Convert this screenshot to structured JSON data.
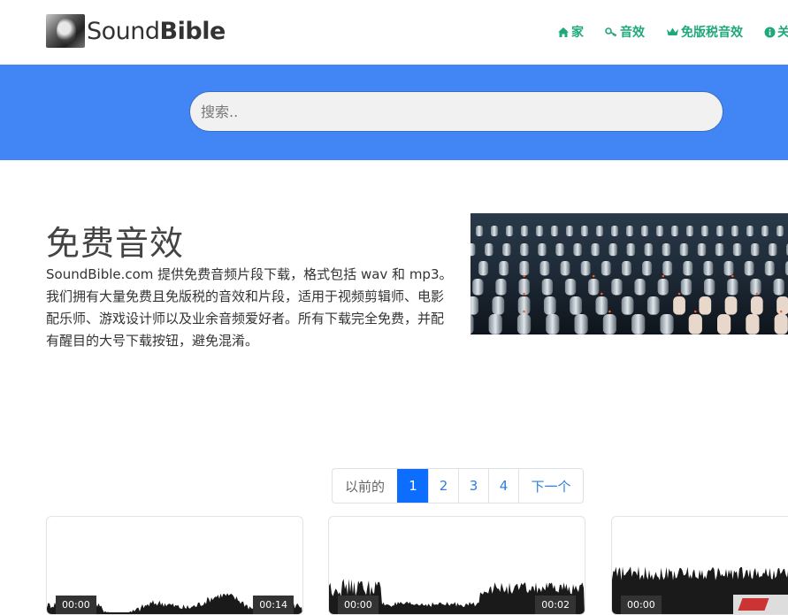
{
  "logo": {
    "brand_light": "Sound",
    "brand_bold": "Bible"
  },
  "nav": [
    {
      "label": "家",
      "icon": "home-icon"
    },
    {
      "label": "音效",
      "icon": "key-icon"
    },
    {
      "label": "免版税音效",
      "icon": "crown-icon"
    },
    {
      "label": "关",
      "icon": "info-icon"
    }
  ],
  "search": {
    "placeholder": "搜索.."
  },
  "hero": {
    "title": "免费音效",
    "description": "SoundBible.com 提供免费音频片段下载，格式包括 wav 和 mp3。我们拥有大量免费且免版税的音效和片段，适用于视频剪辑师、电影配乐师、游戏设计师以及业余音频爱好者。所有下载完全免费，并配有醒目的大号下载按钮，避免混淆。"
  },
  "pagination": {
    "prev": "以前的",
    "pages": [
      "1",
      "2",
      "3",
      "4"
    ],
    "next": "下一个",
    "current": "1"
  },
  "cards": [
    {
      "start": "00:00",
      "end": "00:14"
    },
    {
      "start": "00:00",
      "end": "00:02"
    },
    {
      "start": "00:00",
      "end": ""
    }
  ],
  "colors": {
    "accent_green": "#1fa87a",
    "search_band": "#4285f4",
    "active_page": "#0d6efd"
  }
}
